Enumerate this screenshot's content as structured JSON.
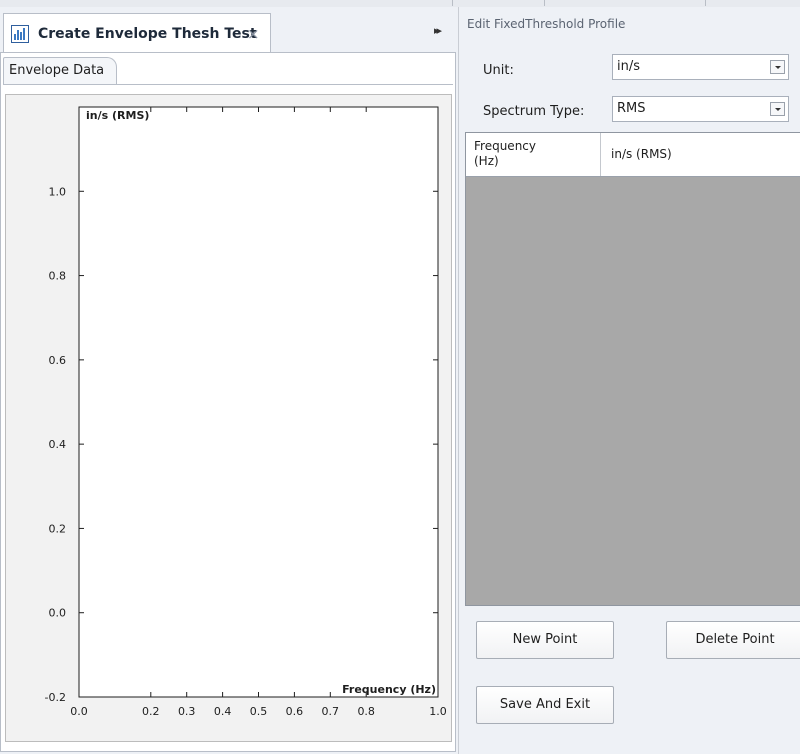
{
  "document_tab": {
    "title": "Create Envelope Thesh Test",
    "close_glyph": "×",
    "icon": "chart-icon"
  },
  "overflow_glyph": "▸▸",
  "subtab": {
    "label": "Envelope Data"
  },
  "chart_data": {
    "type": "line",
    "ylabel": "in/s (RMS)",
    "xlabel": "Frequency (Hz)",
    "xlim": [
      0.0,
      1.0
    ],
    "ylim": [
      -0.2,
      1.2
    ],
    "x_ticks": [
      "0.0",
      "0.2",
      "0.3",
      "0.4",
      "0.5",
      "0.6",
      "0.7",
      "0.8",
      "1.0"
    ],
    "y_ticks": [
      "1.0",
      "0.8",
      "0.6",
      "0.4",
      "0.2",
      "0.0",
      "-0.2"
    ],
    "series": [],
    "grid": false
  },
  "panel": {
    "title": "Edit FixedThreshold Profile",
    "unit_label": "Unit:",
    "unit_value": "in/s",
    "spectrum_label": "Spectrum Type:",
    "spectrum_value": "RMS",
    "grid_headers": [
      "Frequency (Hz)",
      "in/s (RMS)"
    ],
    "rows": [],
    "buttons": {
      "new_point": "New Point",
      "delete_point": "Delete Point",
      "save_exit": "Save And Exit"
    }
  },
  "colors": {
    "grid_empty": "#a8a8a8",
    "panel_bg": "#eef1f6",
    "plot_bg": "#ffffff"
  }
}
